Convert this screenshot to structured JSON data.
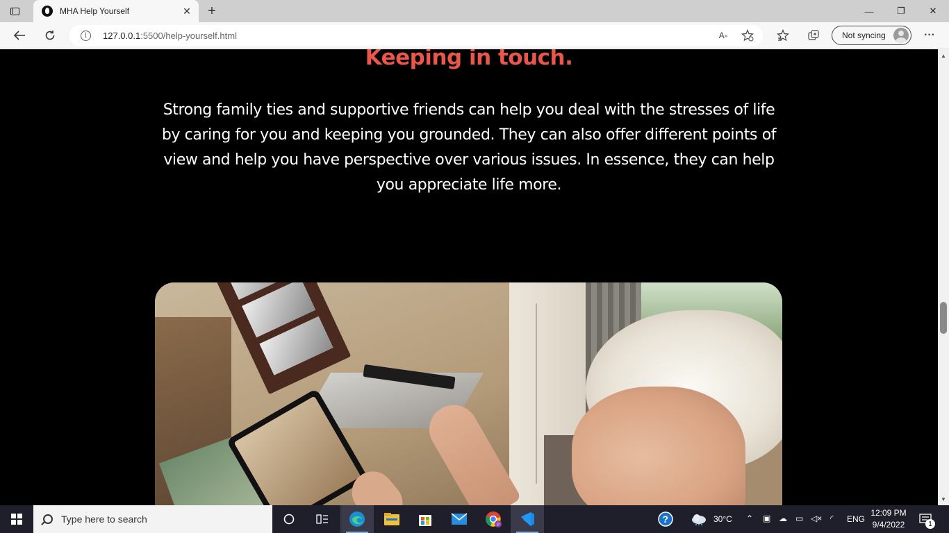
{
  "browser": {
    "tab": {
      "title": "MHA Help Yourself",
      "close": "✕"
    },
    "new_tab": "+",
    "window_controls": {
      "minimize": "—",
      "maximize": "❐",
      "close": "✕"
    },
    "address": {
      "host": "127.0.0.1",
      "path": ":5500/help-yourself.html"
    },
    "sync_label": "Not syncing",
    "more": "···"
  },
  "page": {
    "heading": "Keeping in touch.",
    "paragraph": "Strong family ties and supportive friends can help you deal with the stresses of life by caring for you and keeping you grounded. They can also offer different points of view and help you have perspective over various issues. In essence, they can help you appreciate life more.",
    "heading_color": "#e8574a"
  },
  "taskbar": {
    "search_placeholder": "Type here to search",
    "weather": "30°C",
    "language": "ENG",
    "time": "12:09 PM",
    "date": "9/4/2022",
    "notification_count": "1"
  }
}
